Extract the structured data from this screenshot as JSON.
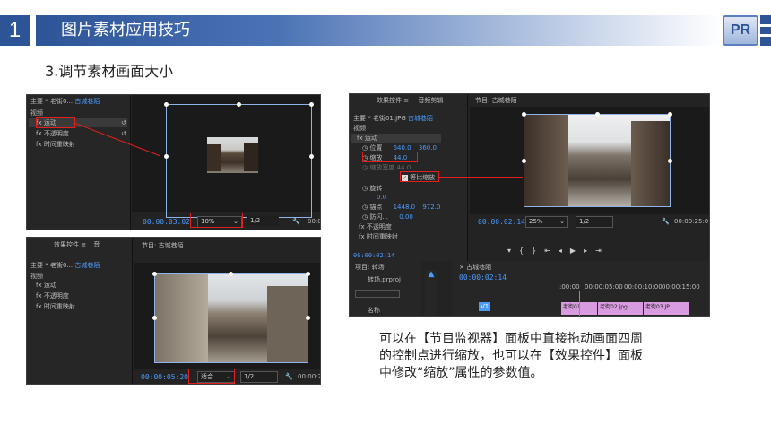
{
  "header": {
    "number": "1",
    "title": "图片素材应用技巧",
    "logo": "PR"
  },
  "subtitle": "3.调节素材画面大小",
  "shot1": {
    "seq_header": "主要 * 老街0...",
    "seq_name": "古城巷陌",
    "section": "视频",
    "rows": [
      "运动",
      "不透明度",
      "时间重映射"
    ],
    "timecode": "00:00:03:02",
    "zoom": "10%",
    "quality": "1/2",
    "timecode_right": "00:0"
  },
  "shot2": {
    "tab_effects": "效果控件",
    "tab_audio": "音",
    "monitor_title": "节目: 古城巷陌",
    "seq_header": "主要 * 老街0...",
    "seq_name": "古城巷陌",
    "section": "视频",
    "rows": [
      "运动",
      "不透明度",
      "时间重映射"
    ],
    "timecode": "00:00:05:20",
    "zoom": "适合",
    "quality": "1/2",
    "timecode_right": "00:00:2"
  },
  "shot3": {
    "tab_effects": "效果控件",
    "tab_audio": "音频剪辑",
    "monitor_title": "节目: 古城巷陌",
    "seq_header": "主要 * 老街01.JPG",
    "seq_name": "古城巷陌",
    "section": "视频",
    "motion": "运动",
    "position_label": "位置",
    "position_x": "640.0",
    "position_y": "360.0",
    "scale_label": "缩放",
    "scale_value": "44.0",
    "scale_width_label": "缩放宽度",
    "scale_width_value": "44.0",
    "uniform_label": "等比缩放",
    "rotation_label": "旋转",
    "rotation_value": "0.0",
    "anchor_label": "锚点",
    "anchor_x": "1448.0",
    "anchor_y": "972.0",
    "flicker_label": "防闪...",
    "flicker_value": "0.00",
    "opacity": "不透明度",
    "timemap": "时间重映射",
    "tc_left": "00:00:02:14",
    "timecode": "00:00:02:14",
    "zoom": "25%",
    "quality": "1/2",
    "timecode_right": "00:00:25:0",
    "project_tab": "项目: 转场",
    "project_file": "转场.prproj",
    "project_col": "名称",
    "timeline_tab": "古城巷陌",
    "timeline_tc": "00:00:02:14",
    "ruler": [
      ":00:00",
      "00:00:05:00",
      "00:00:10:00",
      "00:00:15:00"
    ],
    "track_v1": "V1",
    "clips": [
      "老街01",
      "老街02.jpg",
      "老街03.JP"
    ]
  },
  "description": [
    "可以在【节目监视器】面板中直接拖动画面四周",
    "的控制点进行缩放，也可以在【效果控件】面板",
    "中修改“缩放”属性的参数值。"
  ],
  "colors": {
    "header_blue": "#2c5496",
    "accent_red": "#e02020",
    "premiere_blue": "#4b9bff"
  }
}
